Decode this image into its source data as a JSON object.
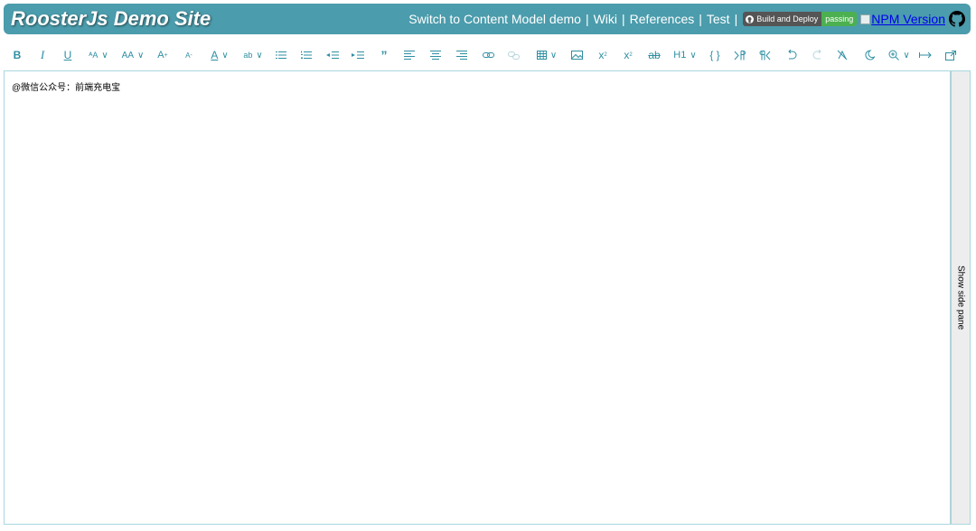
{
  "header": {
    "title": "RoosterJs Demo Site",
    "links": [
      {
        "label": "Switch to Content Model demo"
      },
      {
        "label": "Wiki"
      },
      {
        "label": "References"
      },
      {
        "label": "Test"
      }
    ],
    "badge": {
      "left": "Build and Deploy",
      "right": "passing"
    },
    "npm_label": "NPM Version"
  },
  "toolbar": {
    "bold": "B",
    "italic": "I",
    "underline": "U",
    "font_family": "ᴬA",
    "font_size": "AA",
    "increase_font": "A",
    "decrease_font": "A",
    "text_color": "A",
    "background_color": "ab",
    "quote": "”",
    "superscript": "x",
    "subscript": "x",
    "strikethrough": "ab",
    "header": "H1",
    "code": "{ }",
    "zoom": "⊕"
  },
  "editor": {
    "content": "@微信公众号：前端充电宝"
  },
  "side_pane": {
    "label": "Show side pane"
  }
}
